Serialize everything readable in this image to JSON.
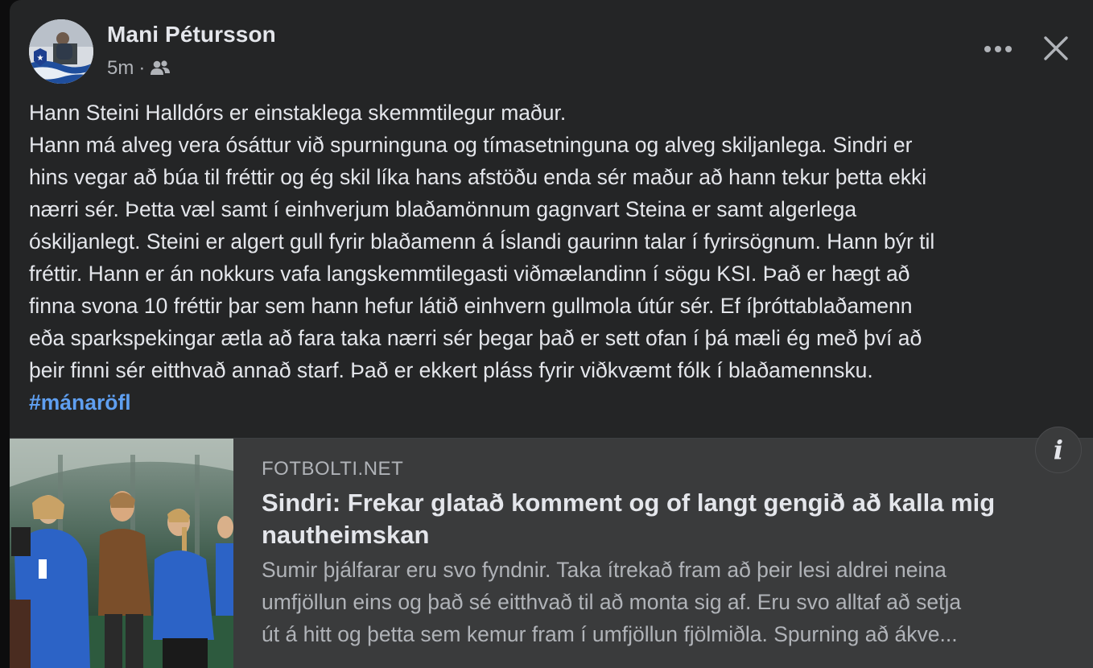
{
  "post": {
    "author_name": "Mani Pétursson",
    "timestamp": "5m",
    "separator": "·",
    "audience_icon": "friends-icon",
    "more_icon": "more-horizontal-icon",
    "close_icon": "close-icon",
    "body_lines": [
      "Hann Steini Halldórs er einstaklega skemmtilegur maður.",
      "Hann má alveg vera ósáttur við spurninguna og tímasetninguna og alveg skiljanlega. Sindri er",
      "hins vegar að búa til fréttir og ég skil líka hans afstöðu enda sér maður að hann tekur þetta ekki",
      "nærri sér.  Þetta væl  samt í einhverjum  blaðamönnum gagnvart Steina er samt algerlega",
      "óskiljanlegt. Steini er algert gull fyrir blaðamenn á Íslandi gaurinn talar í fyrirsögnum. Hann býr til",
      "fréttir. Hann er án nokkurs vafa langskemmtilegasti viðmælandinn í sögu KSI. Það er hægt að",
      "finna svona 10 fréttir þar sem hann hefur látið einhvern gullmola útúr sér. Ef íþróttablaðamenn",
      "eða sparkspekingar ætla að fara taka nærri sér þegar það er sett ofan í þá mæli ég með því að",
      "þeir finni sér eitthvað annað starf. Það er ekkert pláss fyrir viðkvæmt fólk í blaðamennsku."
    ],
    "hashtag": "#mánaröfl"
  },
  "link_preview": {
    "domain": "FOTBOLTI.NET",
    "title": "Sindri: Frekar glatað komment og of langt gengið að kalla mig nautheimskan",
    "description_lines": [
      "Sumir þjálfarar eru svo fyndnir. Taka ítrekað fram að þeir lesi aldrei neina",
      "umfjöllun eins og það sé eitthvað til að monta sig af. Eru svo alltaf að setja",
      "út á hitt og þetta sem kemur fram í umfjöllun fjölmiðla. Spurning að ákve..."
    ],
    "info_icon": "info-icon",
    "info_glyph": "i"
  },
  "colors": {
    "card_background": "#242526",
    "preview_background": "#3a3b3c",
    "primary_text": "#e4e6eb",
    "secondary_text": "#b0b3b8",
    "hashtag": "#5f9ff0"
  }
}
